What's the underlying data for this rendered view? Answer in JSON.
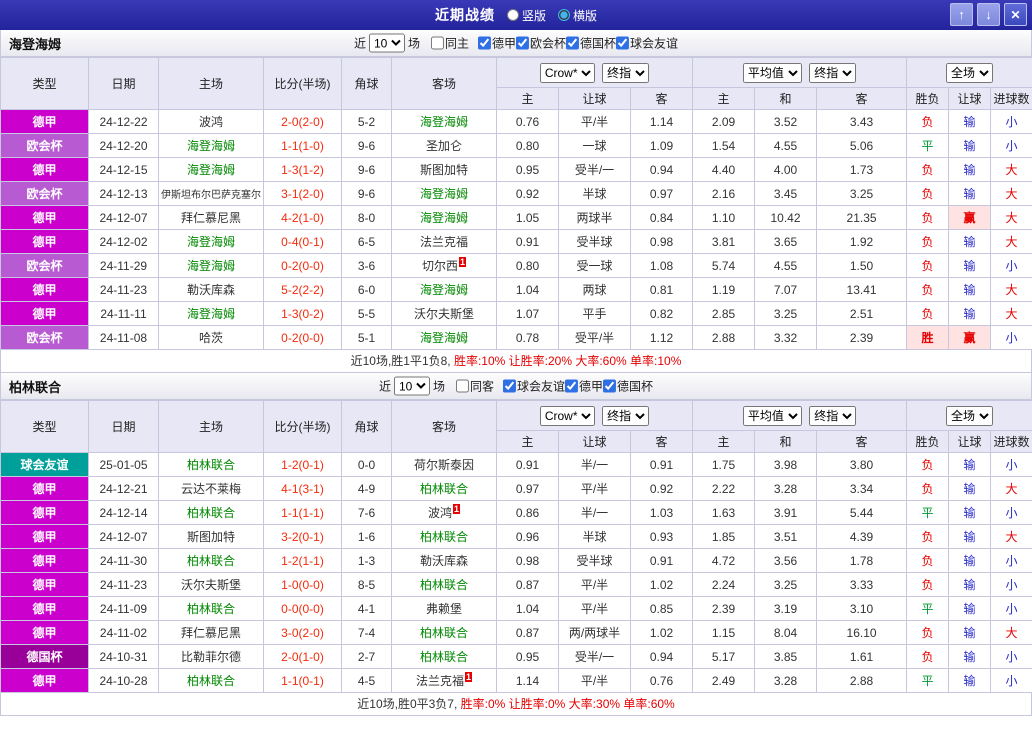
{
  "titlebar": {
    "title": "近期战绩",
    "layout_options": [
      {
        "label": "竖版",
        "selected": false
      },
      {
        "label": "横版",
        "selected": true
      }
    ],
    "up_icon": "↑",
    "down_icon": "↓",
    "close_icon": "✕"
  },
  "columns": {
    "type": "类型",
    "date": "日期",
    "home": "主场",
    "score": "比分(半场)",
    "corner": "角球",
    "away": "客场",
    "odds_company": "Crow*",
    "odds_final": "终指",
    "avg_company": "平均值",
    "avg_final": "终指",
    "scope": "全场",
    "sub": [
      "主",
      "让球",
      "客",
      "主",
      "和",
      "客",
      "胜负",
      "让球",
      "进球数"
    ]
  },
  "league_colors": {
    "德甲": "#cc00cc",
    "欧会杯": "#b85ad2",
    "德国杯": "#990099",
    "球会友谊": "#00a09a"
  },
  "result_colors": {
    "胜": "#e60000",
    "平": "#009933",
    "负": "#e60000",
    "赢": "#e60000",
    "输": "#2929c8",
    "大": "#e60000",
    "小": "#2929c8"
  },
  "focal_team_color": "#008800",
  "score_color": "#f32b0c",
  "sections": [
    {
      "team": "海登海姆",
      "filter": {
        "near": "近",
        "count": "10",
        "games": "场",
        "same_side": "同主",
        "same_checked": false,
        "leagues": [
          {
            "label": "德甲",
            "checked": true
          },
          {
            "label": "欧会杯",
            "checked": true
          },
          {
            "label": "德国杯",
            "checked": true
          },
          {
            "label": "球会友谊",
            "checked": true
          }
        ]
      },
      "rows": [
        {
          "league": "德甲",
          "date": "24-12-22",
          "home": "波鸿",
          "home_focal": false,
          "home_card": "",
          "score": "2-0(2-0)",
          "corner": "5-2",
          "away": "海登海姆",
          "away_focal": true,
          "away_card": "",
          "odds": [
            "0.76",
            "平/半",
            "1.14"
          ],
          "avg": [
            "2.09",
            "3.52",
            "3.43"
          ],
          "results": [
            "负",
            "输",
            "小"
          ]
        },
        {
          "league": "欧会杯",
          "date": "24-12-20",
          "home": "海登海姆",
          "home_focal": true,
          "home_card": "",
          "score": "1-1(1-0)",
          "corner": "9-6",
          "away": "圣加仑",
          "away_focal": false,
          "away_card": "",
          "odds": [
            "0.80",
            "一球",
            "1.09"
          ],
          "avg": [
            "1.54",
            "4.55",
            "5.06"
          ],
          "results": [
            "平",
            "输",
            "小"
          ]
        },
        {
          "league": "德甲",
          "date": "24-12-15",
          "home": "海登海姆",
          "home_focal": true,
          "home_card": "",
          "score": "1-3(1-2)",
          "corner": "9-6",
          "away": "斯图加特",
          "away_focal": false,
          "away_card": "",
          "odds": [
            "0.95",
            "受半/一",
            "0.94"
          ],
          "avg": [
            "4.40",
            "4.00",
            "1.73"
          ],
          "results": [
            "负",
            "输",
            "大"
          ]
        },
        {
          "league": "欧会杯",
          "date": "24-12-13",
          "home": "伊斯坦布尔巴萨克塞尔",
          "home_focal": false,
          "home_card": "",
          "score": "3-1(2-0)",
          "corner": "9-6",
          "away": "海登海姆",
          "away_focal": true,
          "away_card": "",
          "odds": [
            "0.92",
            "半球",
            "0.97"
          ],
          "avg": [
            "2.16",
            "3.45",
            "3.25"
          ],
          "results": [
            "负",
            "输",
            "大"
          ]
        },
        {
          "league": "德甲",
          "date": "24-12-07",
          "home": "拜仁慕尼黑",
          "home_focal": false,
          "home_card": "",
          "score": "4-2(1-0)",
          "corner": "8-0",
          "away": "海登海姆",
          "away_focal": true,
          "away_card": "",
          "odds": [
            "1.05",
            "两球半",
            "0.84"
          ],
          "avg": [
            "1.10",
            "10.42",
            "21.35"
          ],
          "results": [
            "负",
            "赢",
            "大"
          ]
        },
        {
          "league": "德甲",
          "date": "24-12-02",
          "home": "海登海姆",
          "home_focal": true,
          "home_card": "",
          "score": "0-4(0-1)",
          "corner": "6-5",
          "away": "法兰克福",
          "away_focal": false,
          "away_card": "",
          "odds": [
            "0.91",
            "受半球",
            "0.98"
          ],
          "avg": [
            "3.81",
            "3.65",
            "1.92"
          ],
          "results": [
            "负",
            "输",
            "大"
          ]
        },
        {
          "league": "欧会杯",
          "date": "24-11-29",
          "home": "海登海姆",
          "home_focal": true,
          "home_card": "",
          "score": "0-2(0-0)",
          "corner": "3-6",
          "away": "切尔西",
          "away_focal": false,
          "away_card": "1",
          "odds": [
            "0.80",
            "受一球",
            "1.08"
          ],
          "avg": [
            "5.74",
            "4.55",
            "1.50"
          ],
          "results": [
            "负",
            "输",
            "小"
          ]
        },
        {
          "league": "德甲",
          "date": "24-11-23",
          "home": "勒沃库森",
          "home_focal": false,
          "home_card": "",
          "score": "5-2(2-2)",
          "corner": "6-0",
          "away": "海登海姆",
          "away_focal": true,
          "away_card": "",
          "odds": [
            "1.04",
            "两球",
            "0.81"
          ],
          "avg": [
            "1.19",
            "7.07",
            "13.41"
          ],
          "results": [
            "负",
            "输",
            "大"
          ]
        },
        {
          "league": "德甲",
          "date": "24-11-11",
          "home": "海登海姆",
          "home_focal": true,
          "home_card": "",
          "score": "1-3(0-2)",
          "corner": "5-5",
          "away": "沃尔夫斯堡",
          "away_focal": false,
          "away_card": "",
          "odds": [
            "1.07",
            "平手",
            "0.82"
          ],
          "avg": [
            "2.85",
            "3.25",
            "2.51"
          ],
          "results": [
            "负",
            "输",
            "大"
          ]
        },
        {
          "league": "欧会杯",
          "date": "24-11-08",
          "home": "哈茨",
          "home_focal": false,
          "home_card": "",
          "score": "0-2(0-0)",
          "corner": "5-1",
          "away": "海登海姆",
          "away_focal": true,
          "away_card": "",
          "odds": [
            "0.78",
            "受平/半",
            "1.12"
          ],
          "avg": [
            "2.88",
            "3.32",
            "2.39"
          ],
          "results": [
            "胜",
            "赢",
            "小"
          ]
        }
      ],
      "summary_plain": "近10场,胜1平1负8, ",
      "summary_stats": "胜率:10% 让胜率:20% 大率:60% 单率:10%"
    },
    {
      "team": "柏林联合",
      "filter": {
        "near": "近",
        "count": "10",
        "games": "场",
        "same_side": "同客",
        "same_checked": false,
        "leagues": [
          {
            "label": "球会友谊",
            "checked": true
          },
          {
            "label": "德甲",
            "checked": true
          },
          {
            "label": "德国杯",
            "checked": true
          }
        ]
      },
      "rows": [
        {
          "league": "球会友谊",
          "date": "25-01-05",
          "home": "柏林联合",
          "home_focal": true,
          "home_card": "",
          "score": "1-2(0-1)",
          "corner": "0-0",
          "away": "荷尔斯泰因",
          "away_focal": false,
          "away_card": "",
          "odds": [
            "0.91",
            "半/一",
            "0.91"
          ],
          "avg": [
            "1.75",
            "3.98",
            "3.80"
          ],
          "results": [
            "负",
            "输",
            "小"
          ]
        },
        {
          "league": "德甲",
          "date": "24-12-21",
          "home": "云达不莱梅",
          "home_focal": false,
          "home_card": "",
          "score": "4-1(3-1)",
          "corner": "4-9",
          "away": "柏林联合",
          "away_focal": true,
          "away_card": "",
          "odds": [
            "0.97",
            "平/半",
            "0.92"
          ],
          "avg": [
            "2.22",
            "3.28",
            "3.34"
          ],
          "results": [
            "负",
            "输",
            "大"
          ]
        },
        {
          "league": "德甲",
          "date": "24-12-14",
          "home": "柏林联合",
          "home_focal": true,
          "home_card": "",
          "score": "1-1(1-1)",
          "corner": "7-6",
          "away": "波鸿",
          "away_focal": false,
          "away_card": "1",
          "odds": [
            "0.86",
            "半/一",
            "1.03"
          ],
          "avg": [
            "1.63",
            "3.91",
            "5.44"
          ],
          "results": [
            "平",
            "输",
            "小"
          ]
        },
        {
          "league": "德甲",
          "date": "24-12-07",
          "home": "斯图加特",
          "home_focal": false,
          "home_card": "",
          "score": "3-2(0-1)",
          "corner": "1-6",
          "away": "柏林联合",
          "away_focal": true,
          "away_card": "",
          "odds": [
            "0.96",
            "半球",
            "0.93"
          ],
          "avg": [
            "1.85",
            "3.51",
            "4.39"
          ],
          "results": [
            "负",
            "输",
            "大"
          ]
        },
        {
          "league": "德甲",
          "date": "24-11-30",
          "home": "柏林联合",
          "home_focal": true,
          "home_card": "",
          "score": "1-2(1-1)",
          "corner": "1-3",
          "away": "勒沃库森",
          "away_focal": false,
          "away_card": "",
          "odds": [
            "0.98",
            "受半球",
            "0.91"
          ],
          "avg": [
            "4.72",
            "3.56",
            "1.78"
          ],
          "results": [
            "负",
            "输",
            "小"
          ]
        },
        {
          "league": "德甲",
          "date": "24-11-23",
          "home": "沃尔夫斯堡",
          "home_focal": false,
          "home_card": "",
          "score": "1-0(0-0)",
          "corner": "8-5",
          "away": "柏林联合",
          "away_focal": true,
          "away_card": "",
          "odds": [
            "0.87",
            "平/半",
            "1.02"
          ],
          "avg": [
            "2.24",
            "3.25",
            "3.33"
          ],
          "results": [
            "负",
            "输",
            "小"
          ]
        },
        {
          "league": "德甲",
          "date": "24-11-09",
          "home": "柏林联合",
          "home_focal": true,
          "home_card": "",
          "score": "0-0(0-0)",
          "corner": "4-1",
          "away": "弗赖堡",
          "away_focal": false,
          "away_card": "",
          "odds": [
            "1.04",
            "平/半",
            "0.85"
          ],
          "avg": [
            "2.39",
            "3.19",
            "3.10"
          ],
          "results": [
            "平",
            "输",
            "小"
          ]
        },
        {
          "league": "德甲",
          "date": "24-11-02",
          "home": "拜仁慕尼黑",
          "home_focal": false,
          "home_card": "",
          "score": "3-0(2-0)",
          "corner": "7-4",
          "away": "柏林联合",
          "away_focal": true,
          "away_card": "",
          "odds": [
            "0.87",
            "两/两球半",
            "1.02"
          ],
          "avg": [
            "1.15",
            "8.04",
            "16.10"
          ],
          "results": [
            "负",
            "输",
            "大"
          ]
        },
        {
          "league": "德国杯",
          "date": "24-10-31",
          "home": "比勒菲尔德",
          "home_focal": false,
          "home_card": "",
          "score": "2-0(1-0)",
          "corner": "2-7",
          "away": "柏林联合",
          "away_focal": true,
          "away_card": "",
          "odds": [
            "0.95",
            "受半/一",
            "0.94"
          ],
          "avg": [
            "5.17",
            "3.85",
            "1.61"
          ],
          "results": [
            "负",
            "输",
            "小"
          ]
        },
        {
          "league": "德甲",
          "date": "24-10-28",
          "home": "柏林联合",
          "home_focal": true,
          "home_card": "",
          "score": "1-1(0-1)",
          "corner": "4-5",
          "away": "法兰克福",
          "away_focal": false,
          "away_card": "1",
          "odds": [
            "1.14",
            "平/半",
            "0.76"
          ],
          "avg": [
            "2.49",
            "3.28",
            "2.88"
          ],
          "results": [
            "平",
            "输",
            "小"
          ]
        }
      ],
      "summary_plain": "近10场,胜0平3负7, ",
      "summary_stats": "胜率:0% 让胜率:0% 大率:30% 单率:60%"
    }
  ]
}
